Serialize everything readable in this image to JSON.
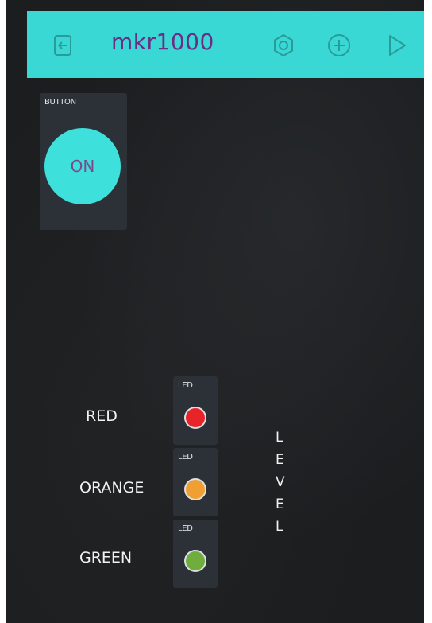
{
  "header": {
    "title": "mkr1000",
    "bar_color": "#39d8d4",
    "icons": {
      "back": "back-door-icon",
      "settings": "hex-nut-settings-icon",
      "add": "plus-circle-icon",
      "play": "play-icon"
    }
  },
  "button_widget": {
    "label": "BUTTON",
    "state_text": "ON",
    "button_color": "#3ee0dc"
  },
  "leds": [
    {
      "widget_label": "LED",
      "name": "RED",
      "color": "#e8242a"
    },
    {
      "widget_label": "LED",
      "name": "ORANGE",
      "color": "#f0a033"
    },
    {
      "widget_label": "LED",
      "name": "GREEN",
      "color": "#6fae3e"
    }
  ],
  "level_letters": [
    "L",
    "E",
    "V",
    "E",
    "L"
  ]
}
